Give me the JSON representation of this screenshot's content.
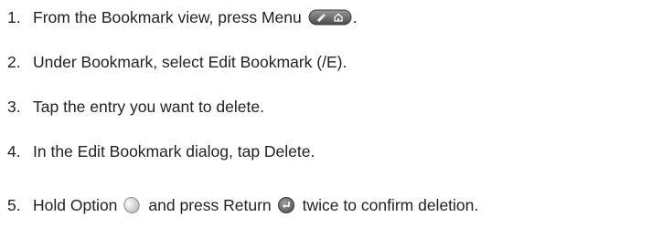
{
  "steps": [
    {
      "number": "1.",
      "text_before": "From the Bookmark view, press Menu",
      "icon": "menu-key-icon",
      "text_after": "."
    },
    {
      "number": "2.",
      "text": "Under Bookmark, select Edit Bookmark (/E)."
    },
    {
      "number": "3.",
      "text": "Tap the entry you want to delete."
    },
    {
      "number": "4.",
      "text": "In the Edit Bookmark dialog, tap Delete."
    },
    {
      "number": "5.",
      "text_before": "Hold Option",
      "icon_1": "option-key-icon",
      "text_middle": "and press Return",
      "icon_2": "return-key-icon",
      "text_after": "twice to confirm deletion."
    }
  ]
}
